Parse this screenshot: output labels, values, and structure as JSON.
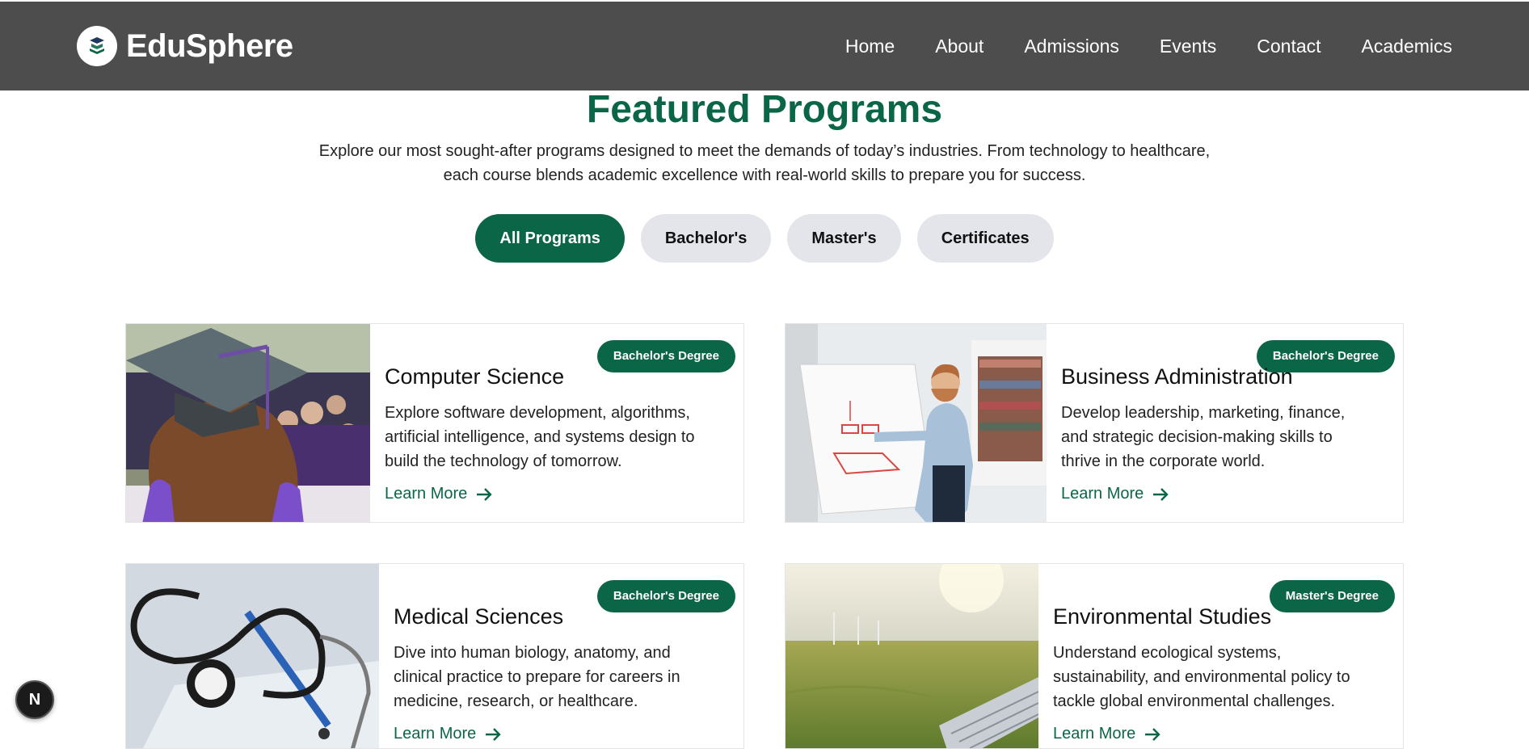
{
  "brand": {
    "name": "EduSphere",
    "icon": "book-stack-icon"
  },
  "nav": [
    "Home",
    "About",
    "Admissions",
    "Events",
    "Contact",
    "Academics"
  ],
  "section": {
    "title": "Featured Programs",
    "description_line1": "Explore our most sought-after programs designed to meet the demands of today’s industries. From technology to healthcare,",
    "description_line2": "each course blends academic excellence with real-world skills to prepare you for success."
  },
  "filters": [
    "All Programs",
    "Bachelor's",
    "Master's",
    "Certificates"
  ],
  "active_filter": "All Programs",
  "cards": [
    {
      "badge": "Bachelor's Degree",
      "title": "Computer Science",
      "text": "Explore software development, algorithms, artificial intelligence, and systems design to build the technology of tomorrow.",
      "link": "Learn More",
      "image": "graduation-photo"
    },
    {
      "badge": "Bachelor's Degree",
      "title": "Business Administration",
      "text": "Develop leadership, marketing, finance, and strategic decision-making skills to thrive in the corporate world.",
      "link": "Learn More",
      "image": "presentation-photo"
    },
    {
      "badge": "Bachelor's Degree",
      "title": "Medical Sciences",
      "text": "Dive into human biology, anatomy, and clinical practice to prepare for careers in medicine, research, or healthcare.",
      "link": "Learn More",
      "image": "stethoscope-photo"
    },
    {
      "badge": "Master's Degree",
      "title": "Environmental Studies",
      "text": "Understand ecological systems, sustainability, and environmental policy to tackle global environmental challenges.",
      "link": "Learn More",
      "image": "wind-farm-photo"
    }
  ],
  "fab": {
    "label": "N"
  },
  "colors": {
    "header": "#4d4d4d",
    "accent": "#0b6647",
    "pill_inactive": "#e4e5ea"
  }
}
